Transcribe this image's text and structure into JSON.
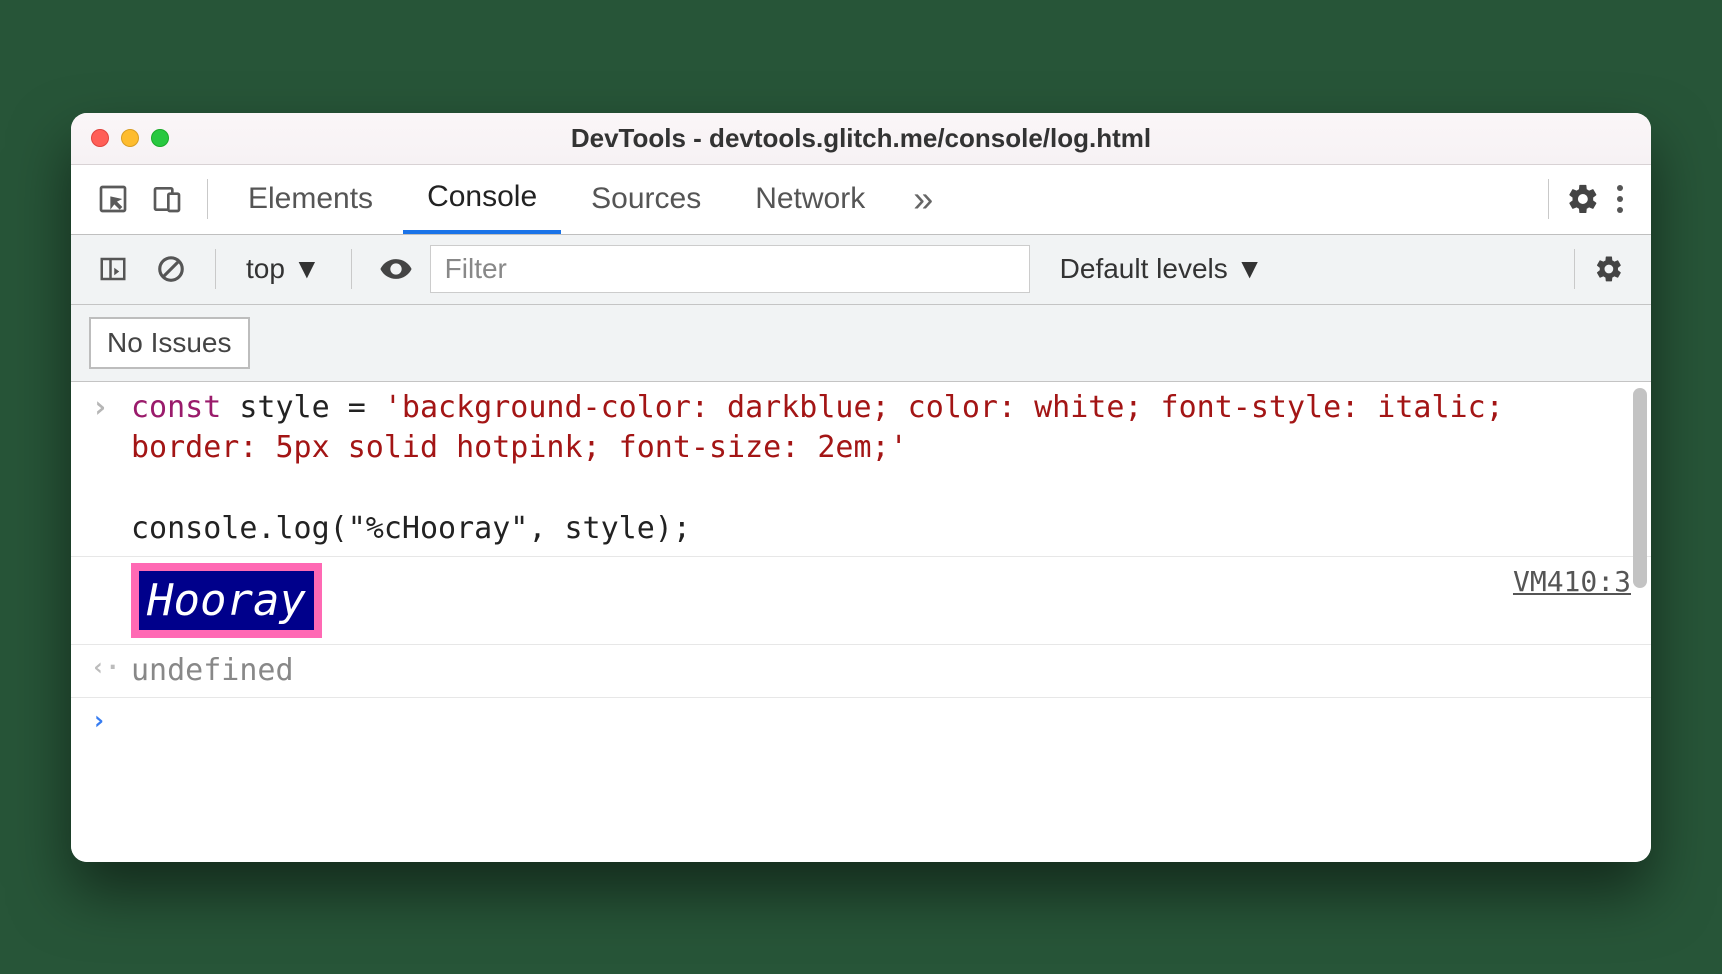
{
  "window": {
    "title": "DevTools - devtools.glitch.me/console/log.html"
  },
  "tabs": {
    "elements": "Elements",
    "console": "Console",
    "sources": "Sources",
    "network": "Network"
  },
  "filterbar": {
    "context": "top",
    "filter_placeholder": "Filter",
    "levels": "Default levels"
  },
  "issues": {
    "label": "No Issues"
  },
  "console": {
    "code_line1_kw": "const",
    "code_line1_rest": " style = ",
    "code_string": "'background-color: darkblue; color: white; font-style: italic; border: 5px solid hotpink; font-size: 2em;'",
    "code_line3": "console.log(\"%cHooray\", style);",
    "styled_text": "Hooray",
    "source_ref": "VM410:3",
    "return_value": "undefined"
  }
}
